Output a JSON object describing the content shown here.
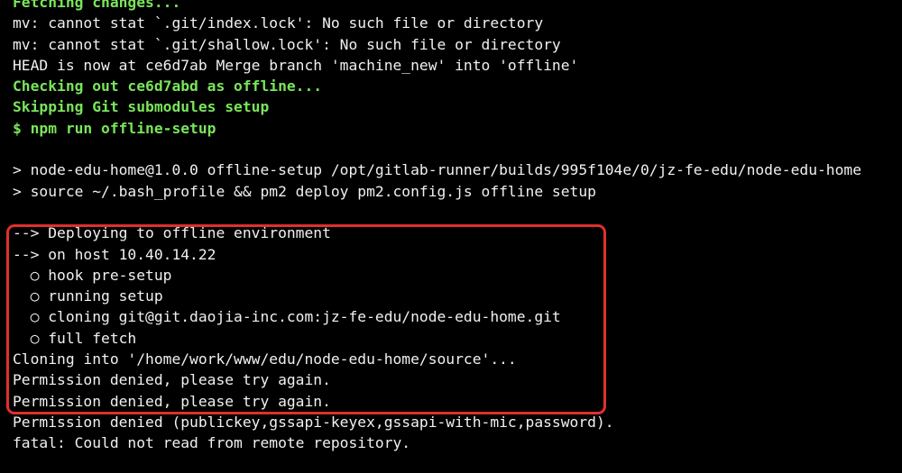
{
  "terminal": {
    "lines": [
      "Fetching changes...",
      "mv: cannot stat `.git/index.lock': No such file or directory",
      "mv: cannot stat `.git/shallow.lock': No such file or directory",
      "HEAD is now at ce6d7ab Merge branch 'machine_new' into 'offline'",
      "Checking out ce6d7abd as offline...",
      "Skipping Git submodules setup",
      "$ npm run offline-setup",
      "",
      "> node-edu-home@1.0.0 offline-setup /opt/gitlab-runner/builds/995f104e/0/jz-fe-edu/node-edu-home",
      "> source ~/.bash_profile && pm2 deploy pm2.config.js offline setup",
      "",
      "--> Deploying to offline environment",
      "--> on host 10.40.14.22",
      "  ○ hook pre-setup",
      "  ○ running setup",
      "  ○ cloning git@git.daojia-inc.com:jz-fe-edu/node-edu-home.git",
      "  ○ full fetch",
      "Cloning into '/home/work/www/edu/node-edu-home/source'...",
      "Permission denied, please try again.",
      "Permission denied, please try again.",
      "Permission denied (publickey,gssapi-keyex,gssapi-with-mic,password).",
      "fatal: Could not read from remote repository."
    ]
  },
  "colors": {
    "background": "#000000",
    "text": "#f0f0f0",
    "status_green": "#79e55a",
    "highlight_red": "#e0302b"
  }
}
